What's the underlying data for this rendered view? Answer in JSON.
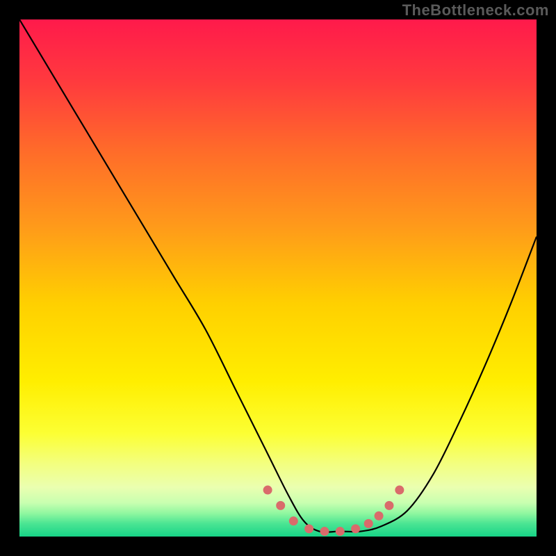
{
  "watermark": "TheBottleneck.com",
  "chart_data": {
    "type": "line",
    "title": "",
    "xlabel": "",
    "ylabel": "",
    "ylim": [
      0,
      100
    ],
    "xlim": [
      0,
      100
    ],
    "series": [
      {
        "name": "bottleneck-curve",
        "x": [
          0,
          6,
          12,
          18,
          24,
          30,
          36,
          42,
          48,
          52,
          55,
          58,
          62,
          66,
          70,
          75,
          80,
          85,
          90,
          95,
          100
        ],
        "values": [
          100,
          90,
          80,
          70,
          60,
          50,
          40,
          28,
          16,
          8,
          3,
          1,
          1,
          1,
          2,
          5,
          12,
          22,
          33,
          45,
          58
        ]
      }
    ],
    "highlight_beads": {
      "x": [
        48,
        50.5,
        53,
        56,
        59,
        62,
        65,
        67.5,
        69.5,
        71.5,
        73.5
      ],
      "values": [
        9,
        6,
        3,
        1.5,
        1,
        1,
        1.5,
        2.5,
        4,
        6,
        9
      ],
      "color": "#d96b6b"
    },
    "gradient_stops": [
      {
        "offset": 0.0,
        "color": "#ff1a4b"
      },
      {
        "offset": 0.12,
        "color": "#ff3a3e"
      },
      {
        "offset": 0.25,
        "color": "#ff6a2a"
      },
      {
        "offset": 0.4,
        "color": "#ff9a1a"
      },
      {
        "offset": 0.55,
        "color": "#ffd000"
      },
      {
        "offset": 0.7,
        "color": "#ffee00"
      },
      {
        "offset": 0.8,
        "color": "#fcff33"
      },
      {
        "offset": 0.86,
        "color": "#f3ff80"
      },
      {
        "offset": 0.905,
        "color": "#eaffb0"
      },
      {
        "offset": 0.935,
        "color": "#c8ffb0"
      },
      {
        "offset": 0.955,
        "color": "#90f7a0"
      },
      {
        "offset": 0.975,
        "color": "#4be593"
      },
      {
        "offset": 1.0,
        "color": "#17d487"
      }
    ]
  }
}
